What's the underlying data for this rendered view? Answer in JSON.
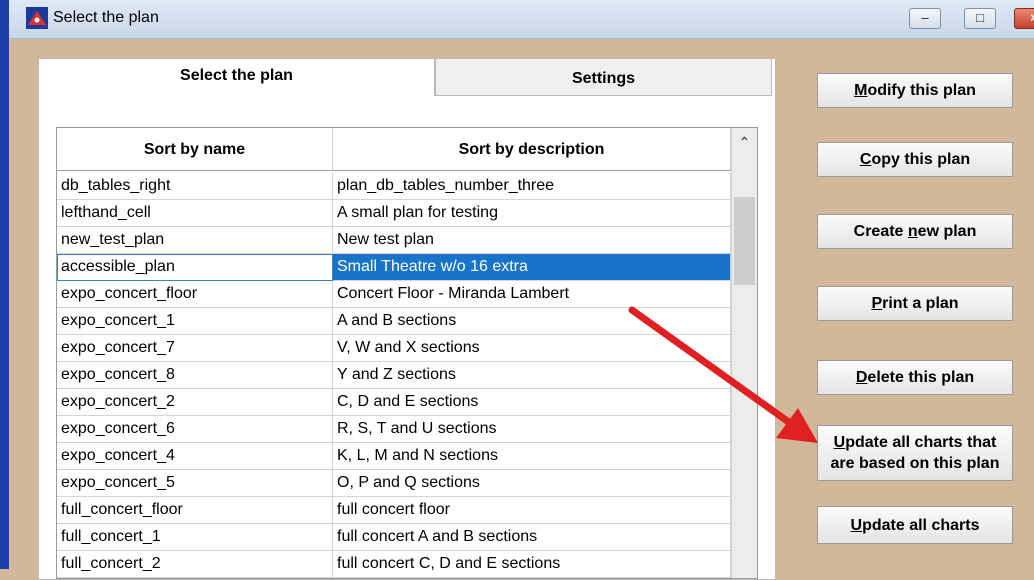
{
  "window": {
    "title": "Select the plan",
    "min_glyph": "–",
    "max_glyph": "□",
    "close_glyph": "×"
  },
  "tabs": [
    {
      "label": "Select the plan",
      "active": true
    },
    {
      "label": "Settings",
      "active": false
    }
  ],
  "grid": {
    "columns": [
      "Sort by name",
      "Sort by description"
    ],
    "selected_index": 3,
    "rows": [
      {
        "name": "db_tables_right",
        "description": "plan_db_tables_number_three"
      },
      {
        "name": "lefthand_cell",
        "description": "A small plan for testing"
      },
      {
        "name": "new_test_plan",
        "description": "New test plan"
      },
      {
        "name": "accessible_plan",
        "description": "Small Theatre w/o 16 extra"
      },
      {
        "name": "expo_concert_floor",
        "description": "Concert Floor - Miranda Lambert"
      },
      {
        "name": "expo_concert_1",
        "description": "A and B sections"
      },
      {
        "name": "expo_concert_7",
        "description": "V, W and X sections"
      },
      {
        "name": "expo_concert_8",
        "description": "Y and Z sections"
      },
      {
        "name": "expo_concert_2",
        "description": "C, D and E sections"
      },
      {
        "name": "expo_concert_6",
        "description": "R, S, T and U sections"
      },
      {
        "name": "expo_concert_4",
        "description": "K, L, M and N sections"
      },
      {
        "name": "expo_concert_5",
        "description": "O, P and Q sections"
      },
      {
        "name": "full_concert_floor",
        "description": "full concert floor"
      },
      {
        "name": "full_concert_1",
        "description": "full concert A and B sections"
      },
      {
        "name": "full_concert_2",
        "description": "full concert C, D and E sections"
      }
    ]
  },
  "buttons": {
    "modify": {
      "u": "M",
      "rest": "odify this plan"
    },
    "copy": {
      "u": "C",
      "rest": "opy this plan"
    },
    "create": {
      "pre": "Create ",
      "u": "n",
      "rest": "ew plan"
    },
    "print": {
      "u": "P",
      "rest": "rint a plan"
    },
    "delete": {
      "u": "D",
      "rest": "elete this plan"
    },
    "update_based": {
      "u": "U",
      "line1_rest": "pdate all charts that",
      "line2": "are based on this plan"
    },
    "update_all": {
      "u": "U",
      "rest": "pdate all charts"
    }
  },
  "colors": {
    "background": "#d2b89b",
    "selection": "#1874c8",
    "arrow": "#e02020"
  }
}
